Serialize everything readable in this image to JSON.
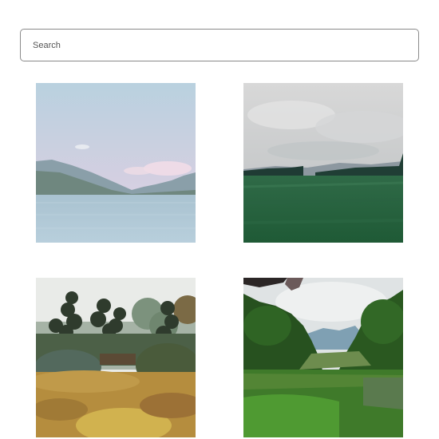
{
  "search": {
    "placeholder": "Search",
    "value": ""
  },
  "gallery": {
    "photos": [
      {
        "subject": "mountain-lake"
      },
      {
        "subject": "green-field-cloudy-sky"
      },
      {
        "subject": "autumn-garden-trees"
      },
      {
        "subject": "green-valley-forest"
      }
    ]
  }
}
